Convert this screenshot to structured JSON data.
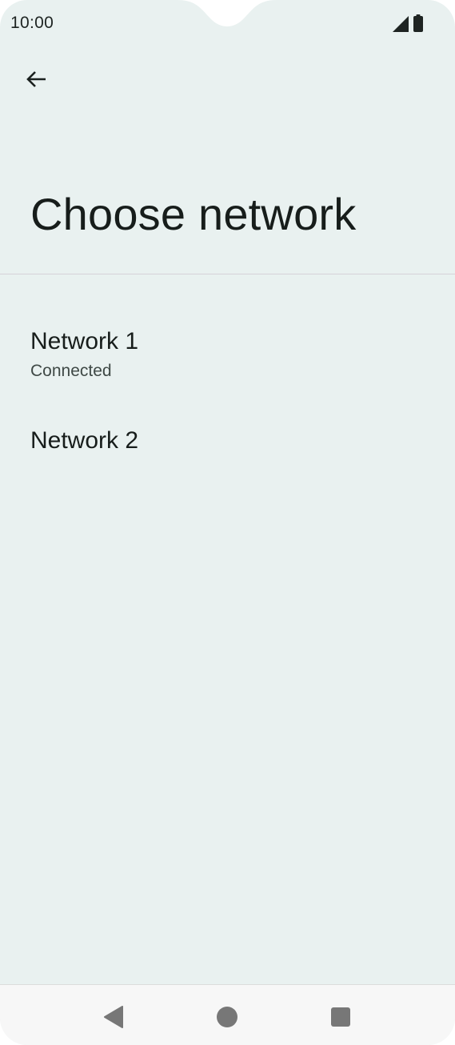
{
  "status_bar": {
    "time": "10:00",
    "icons": [
      "signal-icon",
      "battery-icon"
    ]
  },
  "header": {
    "back_icon": "arrow-left-icon",
    "title": "Choose network"
  },
  "networks": [
    {
      "name": "Network 1",
      "status": "Connected"
    },
    {
      "name": "Network 2"
    }
  ],
  "nav_bar": {
    "icons": [
      "nav-back-icon",
      "nav-home-icon",
      "nav-recents-icon"
    ]
  },
  "colors": {
    "background": "#e9f1f0",
    "text_primary": "#171d1b",
    "text_secondary": "#3f4946",
    "nav_bar": "#f7f7f7"
  }
}
